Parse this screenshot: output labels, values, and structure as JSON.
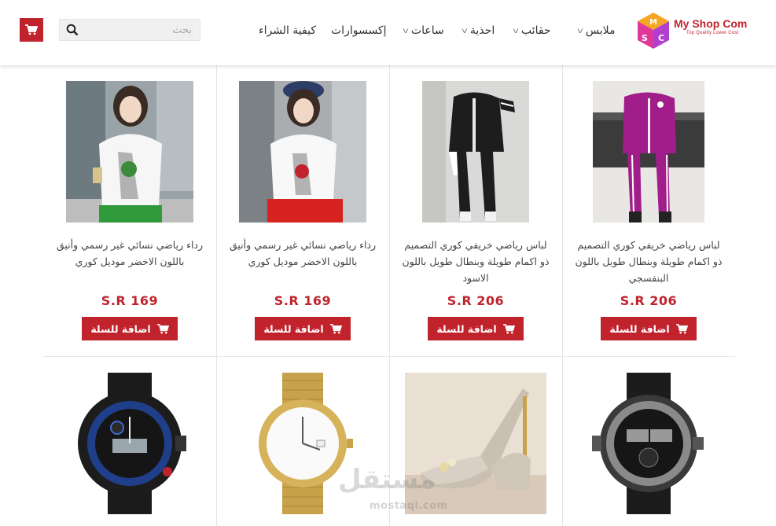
{
  "header": {
    "search_placeholder": "بحث",
    "logo": {
      "brand": "My Shop Com",
      "tagline": "Top Quality Lower Cost",
      "cube_letters": [
        "M",
        "S",
        "C"
      ]
    },
    "nav": [
      {
        "label": "ملابس",
        "dropdown": true
      },
      {
        "label": "حقائب",
        "dropdown": true
      },
      {
        "label": "احذية",
        "dropdown": true
      },
      {
        "label": "ساعات",
        "dropdown": true
      },
      {
        "label": "إكسسوارات",
        "dropdown": false
      },
      {
        "label": "كيفية الشراء",
        "dropdown": false
      }
    ]
  },
  "products": [
    {
      "title": "لباس رياضي خريفي كوري التصميم ذو اكمام طويلة وبنطال طويل باللون البنفسجي",
      "price": "S.R 206",
      "add_label": "اضافة للسلة"
    },
    {
      "title": "لباس رياضي خريفي كوري التصميم ذو اكمام طويلة وبنطال طويل باللون الاسود",
      "price": "S.R 206",
      "add_label": "اضافة للسلة"
    },
    {
      "title": "رداء رياضي نسائي غير رسمي وأنيق باللون الاخضر موديل كوري",
      "price": "S.R 169",
      "add_label": "اضافة للسلة"
    },
    {
      "title": "رداء رياضي نسائي غير رسمي وأنيق باللون الاخضر موديل كوري",
      "price": "S.R 169",
      "add_label": "اضافة للسلة"
    }
  ],
  "watermark": {
    "arabic": "مستقل",
    "latin": "mostaql.com"
  },
  "colors": {
    "accent": "#c0232c",
    "logo_orange": "#f5a623",
    "logo_purple": "#b03fd1"
  }
}
